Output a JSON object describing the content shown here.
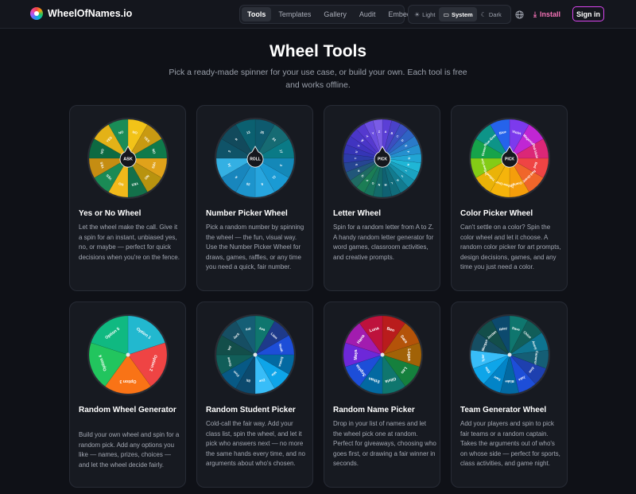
{
  "brand": {
    "name": "WheelOfNames.io"
  },
  "nav": {
    "tabs": [
      "Tools",
      "Templates",
      "Gallery",
      "Audit",
      "Embed"
    ],
    "active": "Tools"
  },
  "theme": {
    "options": [
      {
        "label": "Light",
        "icon": "sun-icon"
      },
      {
        "label": "System",
        "icon": "monitor-icon"
      },
      {
        "label": "Dark",
        "icon": "moon-icon"
      }
    ],
    "active": "System"
  },
  "actions": {
    "install_label": "Install",
    "signin_label": "Sign in"
  },
  "hero": {
    "title": "Wheel Tools",
    "subtitle": "Pick a ready-made spinner for your use case, or build your own. Each tool is free and works offline."
  },
  "cards": [
    {
      "title": "Yes or No Wheel",
      "desc": "Let the wheel make the call. Give it a spin for an instant, unbiased yes, no, or maybe — perfect for quick decisions when you're on the fence.",
      "hub": "ASK",
      "slices": [
        {
          "label": "NO",
          "color": "#f2c318"
        },
        {
          "label": "YES",
          "color": "#c99a12"
        },
        {
          "label": "NO",
          "color": "#0f7a4b"
        },
        {
          "label": "YES",
          "color": "#e0a21a"
        },
        {
          "label": "NO",
          "color": "#b8930f"
        },
        {
          "label": "YES",
          "color": "#13704a"
        },
        {
          "label": "NO",
          "color": "#f1b91a"
        },
        {
          "label": "YES",
          "color": "#1a8a55"
        },
        {
          "label": "YES",
          "color": "#c58d12"
        },
        {
          "label": "NO",
          "color": "#0d6a42"
        },
        {
          "label": "YES",
          "color": "#e3b217"
        },
        {
          "label": "NO",
          "color": "#1a8c57"
        }
      ]
    },
    {
      "title": "Number Picker Wheel",
      "desc": "Pick a random number by spinning the wheel — the fun, visual way. Use the Number Picker Wheel for draws, games, raffles, or any time you need a quick, fair number.",
      "hub": "ROLL",
      "slices": [
        {
          "label": "25",
          "color": "#0e5a6e"
        },
        {
          "label": "24",
          "color": "#166b73"
        },
        {
          "label": "17",
          "color": "#0a7a86"
        },
        {
          "label": "3",
          "color": "#1488b8"
        },
        {
          "label": "11",
          "color": "#1a9ad4"
        },
        {
          "label": "8",
          "color": "#27a5de"
        },
        {
          "label": "20",
          "color": "#1d94cc"
        },
        {
          "label": "6",
          "color": "#1886bd"
        },
        {
          "label": "14",
          "color": "#34b0e3"
        },
        {
          "label": "2",
          "color": "#0f5368"
        },
        {
          "label": "9",
          "color": "#124a5c"
        },
        {
          "label": "13",
          "color": "#0b6070"
        }
      ]
    },
    {
      "title": "Letter Wheel",
      "desc": "Spin for a random letter from A to Z. A handy random letter generator for word games, classroom activities, and creative prompts.",
      "hub": "PICK",
      "slices": [
        {
          "label": "A",
          "color": "#5b3fd6"
        },
        {
          "label": "B",
          "color": "#4a42c8"
        },
        {
          "label": "C",
          "color": "#3b4fc0"
        },
        {
          "label": "D",
          "color": "#2f63c4"
        },
        {
          "label": "E",
          "color": "#2a7ac9"
        },
        {
          "label": "F",
          "color": "#2590cf"
        },
        {
          "label": "G",
          "color": "#21a5d4"
        },
        {
          "label": "H",
          "color": "#1fb6d6"
        },
        {
          "label": "I",
          "color": "#1ba3c1"
        },
        {
          "label": "J",
          "color": "#168fa9"
        },
        {
          "label": "K",
          "color": "#127b8f"
        },
        {
          "label": "L",
          "color": "#106c7b"
        },
        {
          "label": "M",
          "color": "#0f6172"
        },
        {
          "label": "N",
          "color": "#136a6a"
        },
        {
          "label": "O",
          "color": "#17745e"
        },
        {
          "label": "P",
          "color": "#1b7d55"
        },
        {
          "label": "Q",
          "color": "#1f6b63"
        },
        {
          "label": "R",
          "color": "#21577a"
        },
        {
          "label": "S",
          "color": "#264592"
        },
        {
          "label": "T",
          "color": "#2c3ba8"
        },
        {
          "label": "U",
          "color": "#3535b6"
        },
        {
          "label": "V",
          "color": "#4034c0"
        },
        {
          "label": "W",
          "color": "#4a36c8"
        },
        {
          "label": "X",
          "color": "#5539cf"
        },
        {
          "label": "Y",
          "color": "#6b4ee0"
        },
        {
          "label": "Z",
          "color": "#7a5ce6"
        }
      ]
    },
    {
      "title": "Color Picker Wheel",
      "desc": "Can't settle on a color? Spin the color wheel and let it choose. A random color picker for art prompts, design decisions, games, and any time you just need a color.",
      "hub": "PICK",
      "slices": [
        {
          "label": "Violet",
          "color": "#7c3aed"
        },
        {
          "label": "Magenta",
          "color": "#c026d3"
        },
        {
          "label": "Red-Violet",
          "color": "#db2777"
        },
        {
          "label": "Red",
          "color": "#ef4444"
        },
        {
          "label": "Red-Orange",
          "color": "#f0662a"
        },
        {
          "label": "Orange",
          "color": "#f59e0b"
        },
        {
          "label": "Yellow-Orange",
          "color": "#f5b40b"
        },
        {
          "label": "Yellow",
          "color": "#eab308"
        },
        {
          "label": "Yellow-Green",
          "color": "#84cc16"
        },
        {
          "label": "Green",
          "color": "#16a34a"
        },
        {
          "label": "Blue-Green",
          "color": "#0d9488"
        },
        {
          "label": "Blue",
          "color": "#2563eb"
        }
      ]
    },
    {
      "title": "Random Wheel Generator",
      "desc": "Build your own wheel and spin for a random pick. Add any options you like — names, prizes, choices — and let the wheel decide fairly.",
      "hub": "",
      "slices": [
        {
          "label": "Option 1",
          "color": "#22b8cf"
        },
        {
          "label": "Option 2",
          "color": "#ef4444"
        },
        {
          "label": "Option 3",
          "color": "#f97316"
        },
        {
          "label": "Option 4",
          "color": "#22c55e"
        },
        {
          "label": "Option 5",
          "color": "#10b981"
        }
      ]
    },
    {
      "title": "Random Student Picker",
      "desc": "Cold-call the fair way. Add your class list, spin the wheel, and let it pick who answers next — no more the same hands every time, and no arguments about who's chosen.",
      "hub": "",
      "slices": [
        {
          "label": "Ava",
          "color": "#0f766e"
        },
        {
          "label": "Liam",
          "color": "#1e3a8a"
        },
        {
          "label": "Noah",
          "color": "#1d4ed8"
        },
        {
          "label": "Emma",
          "color": "#0369a1"
        },
        {
          "label": "Mia",
          "color": "#0ea5e9"
        },
        {
          "label": "Zoe",
          "color": "#38bdf8"
        },
        {
          "label": "Eli",
          "color": "#0c4a6e"
        },
        {
          "label": "Finn",
          "color": "#075985"
        },
        {
          "label": "Grace",
          "color": "#115e59"
        },
        {
          "label": "Ivy",
          "color": "#134e4a"
        },
        {
          "label": "Jack",
          "color": "#164e63"
        },
        {
          "label": "Kai",
          "color": "#155e75"
        }
      ]
    },
    {
      "title": "Random Name Picker",
      "desc": "Drop in your list of names and let the wheel pick one at random. Perfect for giveaways, choosing who goes first, or drawing a fair winner in seconds.",
      "hub": "",
      "slices": [
        {
          "label": "Ben",
          "color": "#b91c1c"
        },
        {
          "label": "Sara",
          "color": "#b45309"
        },
        {
          "label": "Logan",
          "color": "#a16207"
        },
        {
          "label": "Leo",
          "color": "#15803d"
        },
        {
          "label": "Olivia",
          "color": "#0f766e"
        },
        {
          "label": "Ethan",
          "color": "#0369a1"
        },
        {
          "label": "Sophia",
          "color": "#1d4ed8"
        },
        {
          "label": "Maya",
          "color": "#6d28d9"
        },
        {
          "label": "Hana",
          "color": "#a21caf"
        },
        {
          "label": "Luna",
          "color": "#be123c"
        }
      ]
    },
    {
      "title": "Team Generator Wheel",
      "desc": "Add your players and spin to pick fair teams or a random captain. Takes the arguments out of who's on whose side — perfect for sports, class activities, and game night.",
      "hub": "",
      "slices": [
        {
          "label": "Dave",
          "color": "#0f766e"
        },
        {
          "label": "Chloe",
          "color": "#115e59"
        },
        {
          "label": "Avery",
          "color": "#0e7490"
        },
        {
          "label": "Cameron",
          "color": "#155e75"
        },
        {
          "label": "Alex",
          "color": "#1e40af"
        },
        {
          "label": "Jake",
          "color": "#1d4ed8"
        },
        {
          "label": "Blake",
          "color": "#0369a1"
        },
        {
          "label": "Sam",
          "color": "#0284c7"
        },
        {
          "label": "Ellie",
          "color": "#0ea5e9"
        },
        {
          "label": "Tyler",
          "color": "#38bdf8"
        },
        {
          "label": "Morgan",
          "color": "#164e63"
        },
        {
          "label": "Jordan",
          "color": "#134e4a"
        },
        {
          "label": "Riley",
          "color": "#0c4a6e"
        }
      ]
    }
  ]
}
